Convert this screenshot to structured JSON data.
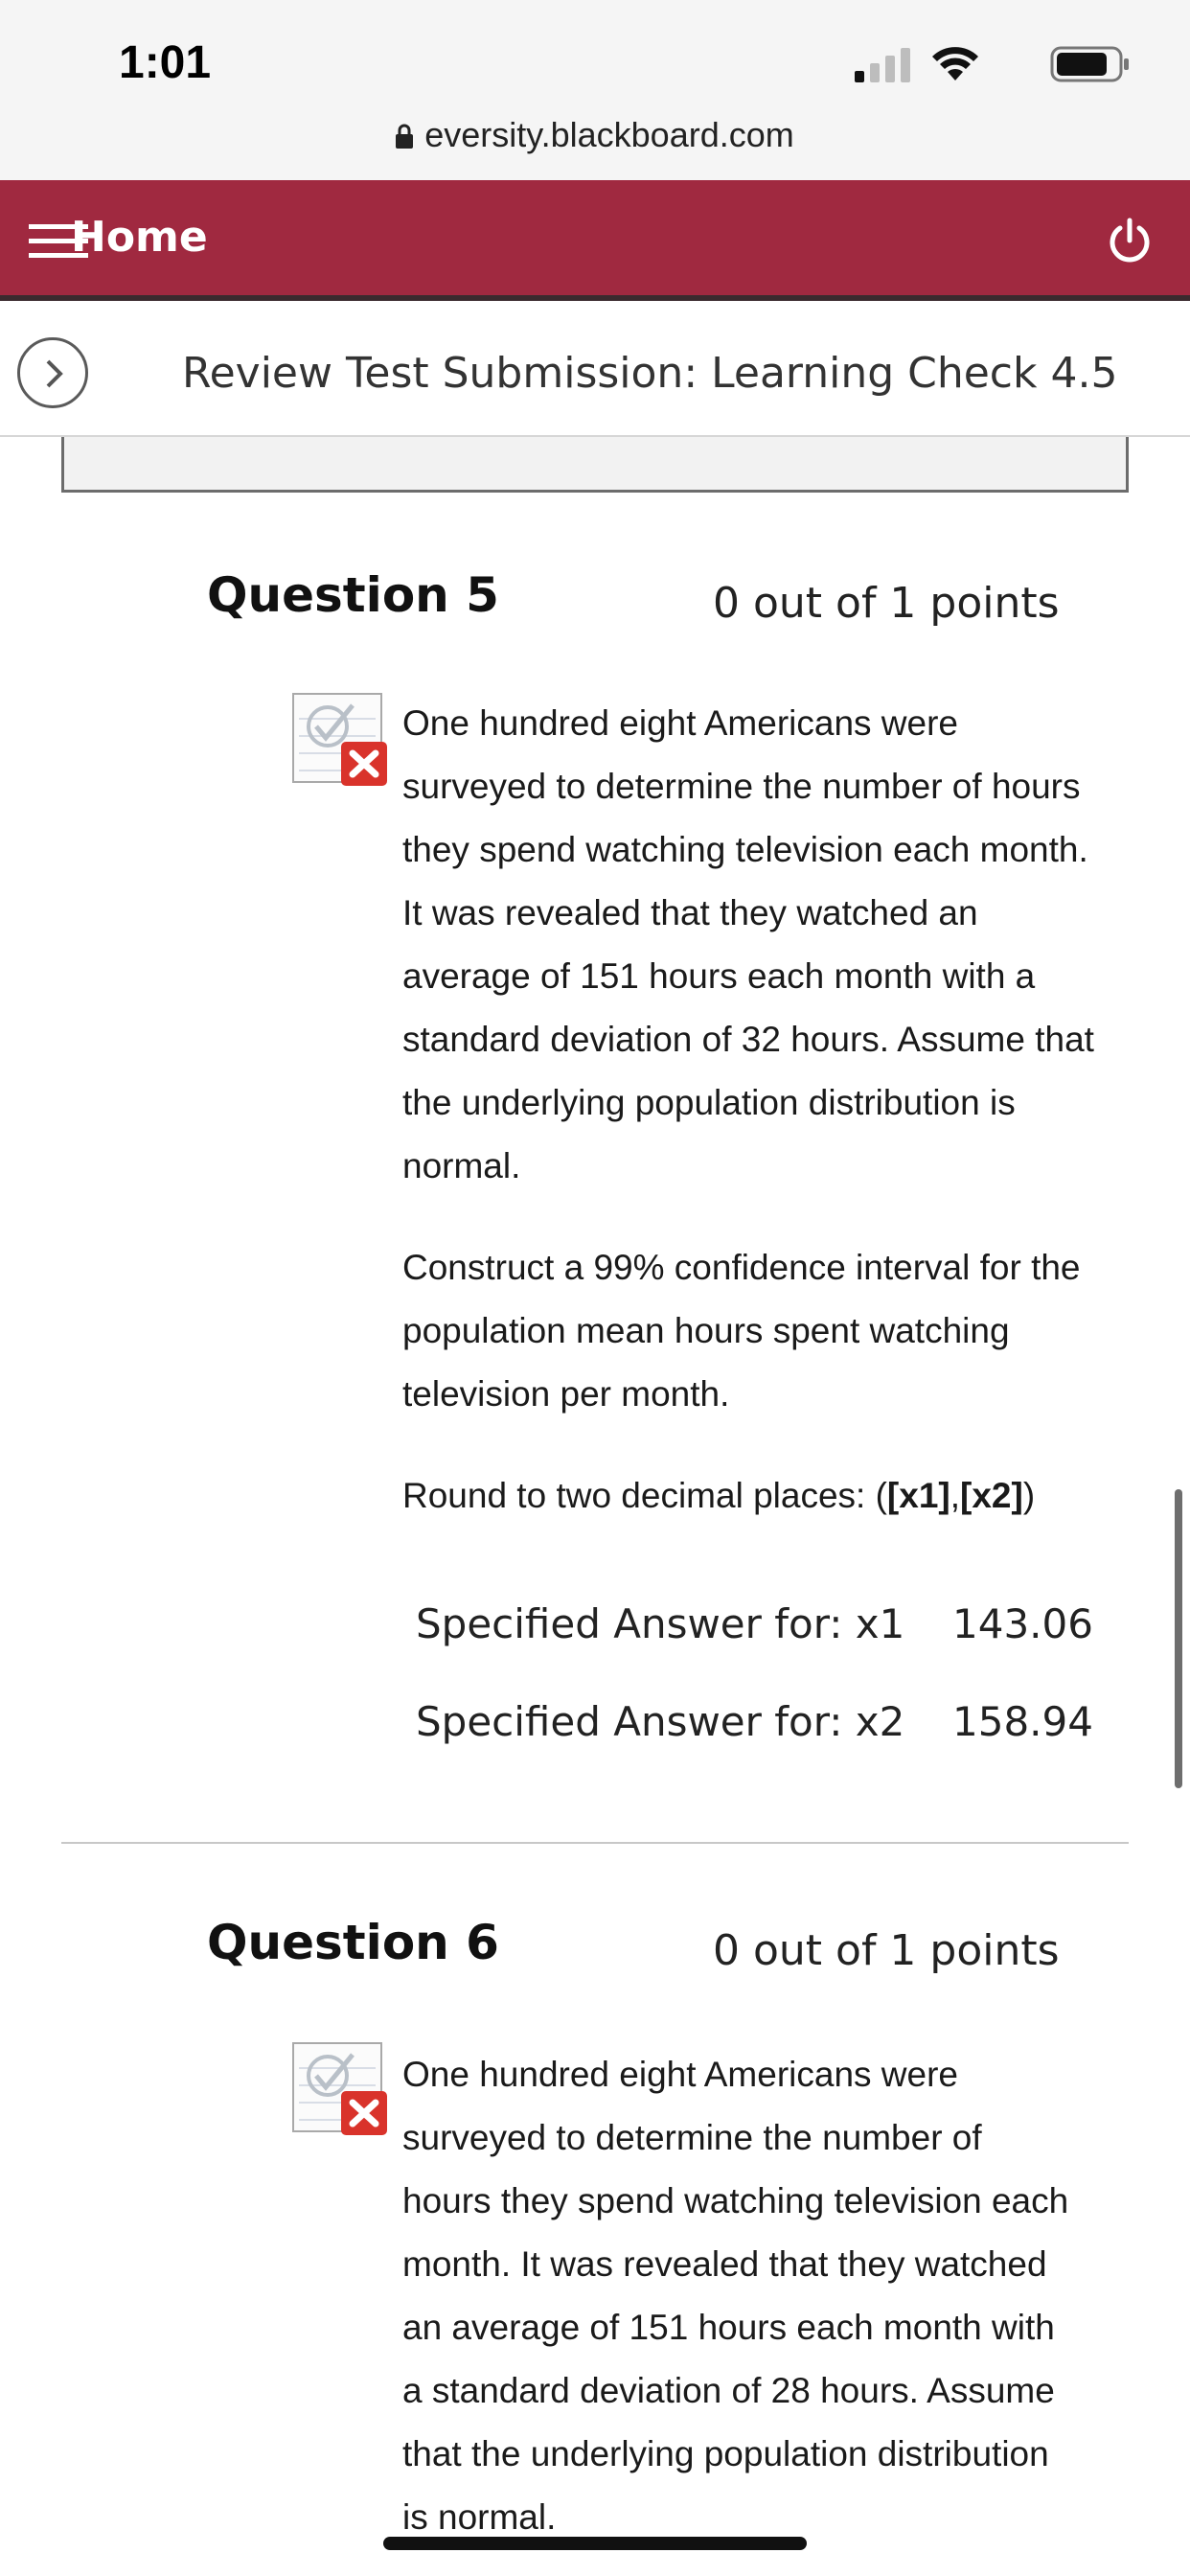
{
  "status_bar": {
    "time": "1:01"
  },
  "browser": {
    "url": "eversity.blackboard.com"
  },
  "header": {
    "home_label": "Home"
  },
  "title_bar": {
    "title": "Review Test Submission: Learning Check 4.5"
  },
  "questions": [
    {
      "heading": "Question 5",
      "points": "0 out of 1 points",
      "paragraphs": [
        "One hundred eight Americans were surveyed to determine the number of hours they spend watching television each month. It was revealed that they watched an average of 151 hours each month with a standard deviation of 32 hours. Assume that the underlying population distribution is normal.",
        "Construct a 99% confidence interval for the population mean hours spent watching television per month."
      ],
      "round_prefix": "Round to two decimal places: (",
      "placeholder_1": "[x1]",
      "separator": ",",
      "placeholder_2": "[x2]",
      "round_suffix": ")",
      "answers": [
        {
          "label": "Specified Answer for: x1",
          "value": "143.06"
        },
        {
          "label": "Specified Answer for: x2",
          "value": "158.94"
        }
      ]
    },
    {
      "heading": "Question 6",
      "points": "0 out of 1 points",
      "paragraphs": [
        "One hundred eight Americans were surveyed to determine the number of hours they spend watching television each month. It was revealed that they watched an average of 151 hours each month with a standard deviation of 28 hours. Assume that the underlying population distribution is normal."
      ]
    }
  ],
  "colors": {
    "header_bg": "#a02940",
    "incorrect_red": "#d9332b"
  }
}
